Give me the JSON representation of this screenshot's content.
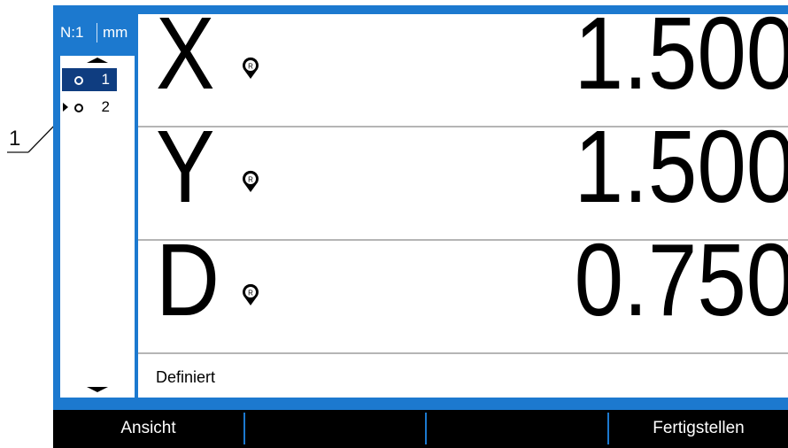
{
  "callout": {
    "label": "1"
  },
  "header": {
    "n_label": "N:1",
    "unit": "mm"
  },
  "feature_list": {
    "items": [
      {
        "number": "1",
        "selected": true,
        "pointer": false
      },
      {
        "number": "2",
        "selected": false,
        "pointer": true
      }
    ]
  },
  "readouts": [
    {
      "axis": "X",
      "value": "1.500",
      "icon": "reference-pin-icon"
    },
    {
      "axis": "Y",
      "value": "1.500",
      "icon": "reference-pin-icon"
    },
    {
      "axis": "D",
      "value": "0.750",
      "icon": "reference-pin-icon"
    }
  ],
  "status": {
    "text": "Definiert"
  },
  "softkeys": [
    {
      "label": "Ansicht"
    },
    {
      "label": ""
    },
    {
      "label": ""
    },
    {
      "label": "Fertigstellen"
    }
  ],
  "colors": {
    "frame": "#1c79cf",
    "selection": "#0f3d80",
    "softkey_bar": "#000000"
  }
}
